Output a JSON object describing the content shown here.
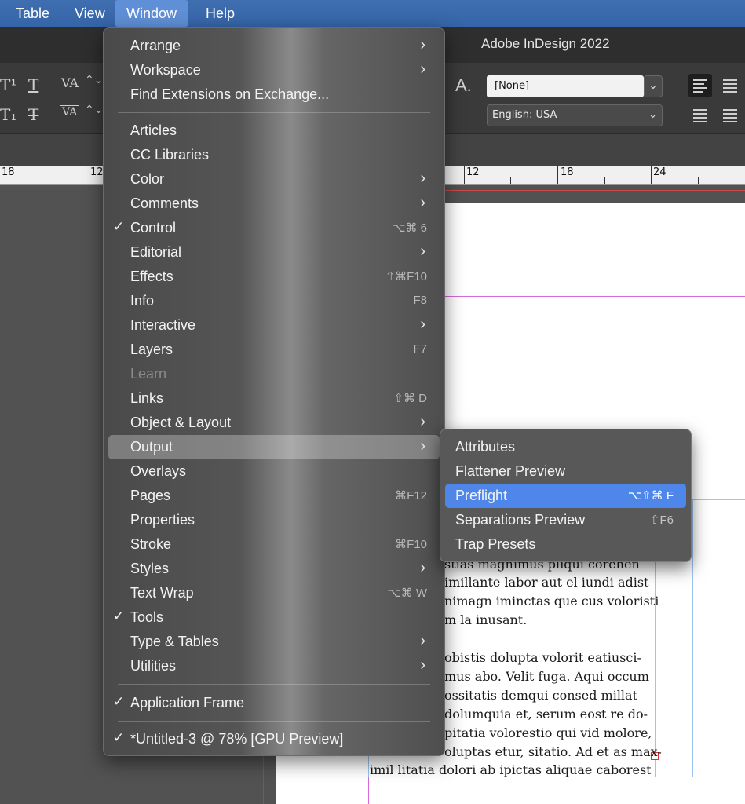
{
  "menubar": {
    "items": [
      {
        "label": "Table"
      },
      {
        "label": "View"
      },
      {
        "label": "Window",
        "active": true
      },
      {
        "label": "Help"
      }
    ]
  },
  "app": {
    "title": "Adobe InDesign 2022"
  },
  "control_panel": {
    "char_style": "[None]",
    "language": "English: USA"
  },
  "ruler": {
    "labels": [
      "18",
      "12",
      "12",
      "18",
      "24"
    ]
  },
  "window_menu": {
    "items": [
      {
        "label": "Arrange",
        "submenu": true
      },
      {
        "label": "Workspace",
        "submenu": true
      },
      {
        "label": "Find Extensions on Exchange..."
      },
      {
        "label": "Articles"
      },
      {
        "label": "CC Libraries"
      },
      {
        "label": "Color",
        "submenu": true
      },
      {
        "label": "Comments",
        "submenu": true
      },
      {
        "label": "Control",
        "checked": true,
        "shortcut": "⌥⌘ 6"
      },
      {
        "label": "Editorial",
        "submenu": true
      },
      {
        "label": "Effects",
        "shortcut": "⇧⌘F10"
      },
      {
        "label": "Info",
        "shortcut": "F8"
      },
      {
        "label": "Interactive",
        "submenu": true
      },
      {
        "label": "Layers",
        "shortcut": "F7"
      },
      {
        "label": "Learn",
        "disabled": true
      },
      {
        "label": "Links",
        "shortcut": "⇧⌘ D"
      },
      {
        "label": "Object & Layout",
        "submenu": true
      },
      {
        "label": "Output",
        "submenu": true,
        "highlighted": true
      },
      {
        "label": "Overlays"
      },
      {
        "label": "Pages",
        "shortcut": "⌘F12"
      },
      {
        "label": "Properties"
      },
      {
        "label": "Stroke",
        "shortcut": "⌘F10"
      },
      {
        "label": "Styles",
        "submenu": true
      },
      {
        "label": "Text Wrap",
        "shortcut": "⌥⌘ W"
      },
      {
        "label": "Tools",
        "checked": true
      },
      {
        "label": "Type & Tables",
        "submenu": true
      },
      {
        "label": "Utilities",
        "submenu": true
      },
      {
        "label": "Application Frame",
        "checked": true
      },
      {
        "label": "*Untitled-3 @ 78% [GPU Preview]",
        "checked": true
      }
    ]
  },
  "output_submenu": {
    "items": [
      {
        "label": "Attributes"
      },
      {
        "label": "Flattener Preview"
      },
      {
        "label": "Preflight",
        "shortcut": "⌥⇧⌘ F",
        "selected": true
      },
      {
        "label": "Separations Preview",
        "shortcut": "⇧F6"
      },
      {
        "label": "Trap Presets"
      }
    ]
  },
  "document_text": {
    "lines": [
      "stias magnimus pliqui corehen",
      "imillante labor aut el iundi adist",
      "nimagn iminctas que cus voloristi",
      "m la inusant.",
      "obistis dolupta volorit eatiusci-",
      "mus abo. Velit fuga. Aqui occum",
      "ossitatis demqui consed millat",
      "dolumquia et, serum eost re do-",
      "pitatia volorestio qui vid molore,",
      "oluptas etur, sitatio. Ad et as max-",
      "imil litatia dolori ab ipictas aliquae caborest"
    ]
  },
  "colors": {
    "menubar_bg": "#3564a8",
    "selection": "#4f86ea",
    "margin_guide": "#d46bdc",
    "frame_edge": "#9ec4f0"
  }
}
